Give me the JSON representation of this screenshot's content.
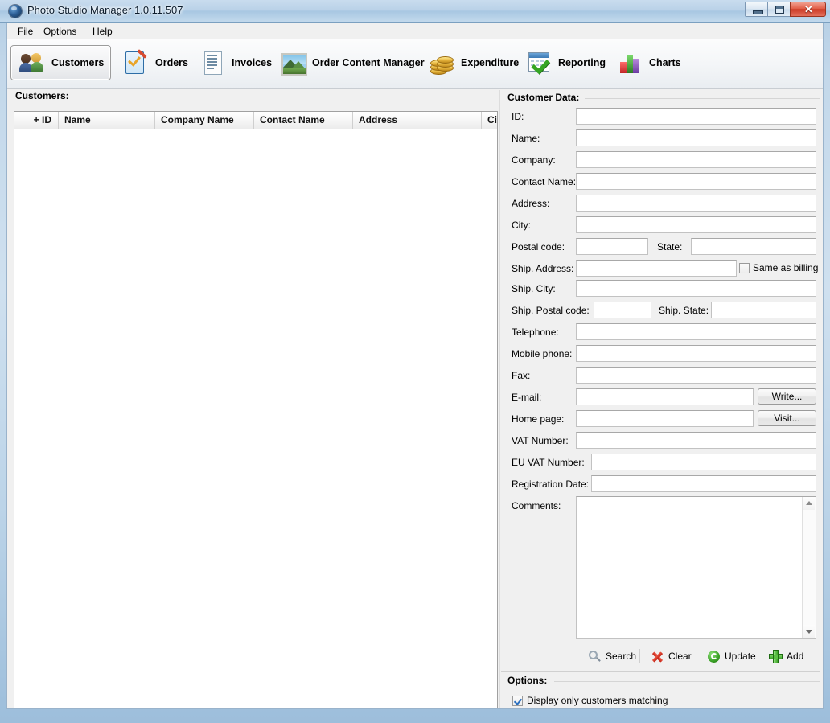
{
  "window": {
    "title": "Photo Studio Manager 1.0.11.507",
    "app_icon": "camera-lens-icon",
    "controls": {
      "minimize": "minimize-button",
      "maximize": "maximize-button",
      "close_glyph": "✕"
    }
  },
  "menu": {
    "items": [
      {
        "label": "File"
      },
      {
        "label": "Options"
      },
      {
        "label": "Help"
      }
    ]
  },
  "toolbar": {
    "buttons": [
      {
        "label": "Customers",
        "icon": "two-people-icon",
        "selected": true
      },
      {
        "label": "Orders",
        "icon": "clipboard-check-pen-icon",
        "selected": false
      },
      {
        "label": "Invoices",
        "icon": "document-lines-icon",
        "selected": false
      },
      {
        "label": "Order Content Manager",
        "icon": "landscape-photo-icon",
        "selected": false
      },
      {
        "label": "Expenditure",
        "icon": "gold-coins-icon",
        "selected": false
      },
      {
        "label": "Reporting",
        "icon": "calendar-check-icon",
        "selected": false
      },
      {
        "label": "Charts",
        "icon": "bar-chart-icon",
        "selected": false
      }
    ]
  },
  "grid": {
    "caption": "Customers:",
    "columns": [
      {
        "label": "+ ID"
      },
      {
        "label": "Name"
      },
      {
        "label": "Company Name"
      },
      {
        "label": "Contact Name"
      },
      {
        "label": "Address"
      },
      {
        "label": "Cit"
      }
    ],
    "rows": [],
    "hscroll": {
      "left_arrow": "◄",
      "right_arrow": "►"
    }
  },
  "customer_data": {
    "caption": "Customer Data:",
    "fields": [
      {
        "label": "ID:",
        "value": "",
        "placeholder": ""
      },
      {
        "label": "Name:",
        "value": "",
        "placeholder": ""
      },
      {
        "label": "Company:",
        "value": "",
        "placeholder": ""
      },
      {
        "label": "Contact Name:",
        "value": "",
        "placeholder": ""
      },
      {
        "label": "Address:",
        "value": "",
        "placeholder": ""
      },
      {
        "label": "City:",
        "value": "",
        "placeholder": ""
      },
      {
        "label": "Postal code:",
        "value": "",
        "placeholder": ""
      },
      {
        "label": "State:",
        "value": "",
        "placeholder": ""
      },
      {
        "label": "Ship. Address:",
        "value": "",
        "placeholder": ""
      },
      {
        "label": "Ship. City:",
        "value": "",
        "placeholder": ""
      },
      {
        "label": "Ship. Postal code:",
        "value": "",
        "placeholder": ""
      },
      {
        "label": "Ship. State:",
        "value": "",
        "placeholder": ""
      },
      {
        "label": "Telephone:",
        "value": "",
        "placeholder": ""
      },
      {
        "label": "Mobile phone:",
        "value": "",
        "placeholder": ""
      },
      {
        "label": "Fax:",
        "value": "",
        "placeholder": ""
      },
      {
        "label": "E-mail:",
        "value": "",
        "placeholder": ""
      },
      {
        "label": "Home page:",
        "value": "",
        "placeholder": ""
      },
      {
        "label": "VAT Number:",
        "value": "",
        "placeholder": ""
      },
      {
        "label": "EU VAT Number:",
        "value": "",
        "placeholder": ""
      },
      {
        "label": "Registration Date:",
        "value": "",
        "placeholder": ""
      },
      {
        "label": "Comments:",
        "value": "",
        "placeholder": ""
      }
    ],
    "same_as_billing": {
      "label": "Same as billing",
      "checked": false
    },
    "write_button": "Write...",
    "visit_button": "Visit..."
  },
  "actions": [
    {
      "label": "Search",
      "icon": "magnifier-icon"
    },
    {
      "label": "Clear",
      "icon": "red-x-icon"
    },
    {
      "label": "Update",
      "icon": "green-refresh-icon"
    },
    {
      "label": "Add",
      "icon": "green-plus-icon"
    }
  ],
  "options": {
    "caption": "Options:",
    "display_matching": {
      "label": "Display only customers matching",
      "checked": true
    }
  },
  "colors": {
    "accent": "#3d7ab5",
    "close_button": "#cc3b26",
    "selection": "#cde4f7",
    "frame": "#b3cde4"
  }
}
